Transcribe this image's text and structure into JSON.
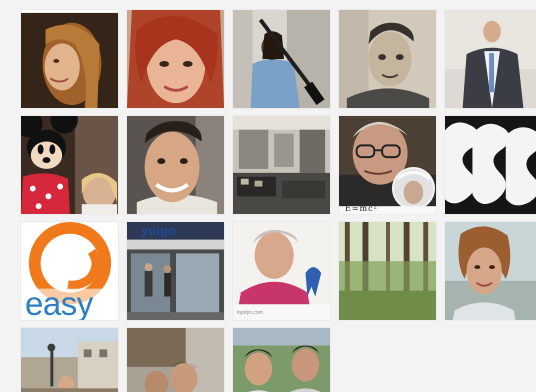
{
  "gallery": {
    "tiles": [
      {
        "subject": "woman-blonde-profile-photo"
      },
      {
        "subject": "woman-red-hair-selfie-photo"
      },
      {
        "subject": "man-with-camera-pole-photo"
      },
      {
        "subject": "boy-black-white-portrait-photo"
      },
      {
        "subject": "older-man-in-suit-photo"
      },
      {
        "subject": "minnie-mouse-with-child-photo"
      },
      {
        "subject": "smiling-man-portrait-photo"
      },
      {
        "subject": "shop-interior-photo"
      },
      {
        "subject": "older-man-with-glasses-einstein-badge-photo",
        "badge_text": "E=mc²"
      },
      {
        "subject": "ss-lettering-graphic"
      },
      {
        "subject": "easy-logo-graphic",
        "logo_text": "easy"
      },
      {
        "subject": "storefront-yoigo-photo",
        "sign_text": "yoigo"
      },
      {
        "subject": "woman-with-awareness-ribbon-photo",
        "caption_text": "topdyn.com"
      },
      {
        "subject": "forest-trees-photo"
      },
      {
        "subject": "woman-outdoors-portrait-photo"
      },
      {
        "subject": "street-buildings-photo"
      },
      {
        "subject": "people-outdoor-photo"
      },
      {
        "subject": "two-men-outdoor-photo"
      }
    ]
  },
  "colors": {
    "page_background": "#f3f3f3",
    "tile_border": "#ececec",
    "easy_orange": "#f07a1b",
    "easy_blue": "#2b7fc4",
    "yoigo_blue": "#1d4a9b",
    "ribbon_blue": "#2e5fb0"
  }
}
